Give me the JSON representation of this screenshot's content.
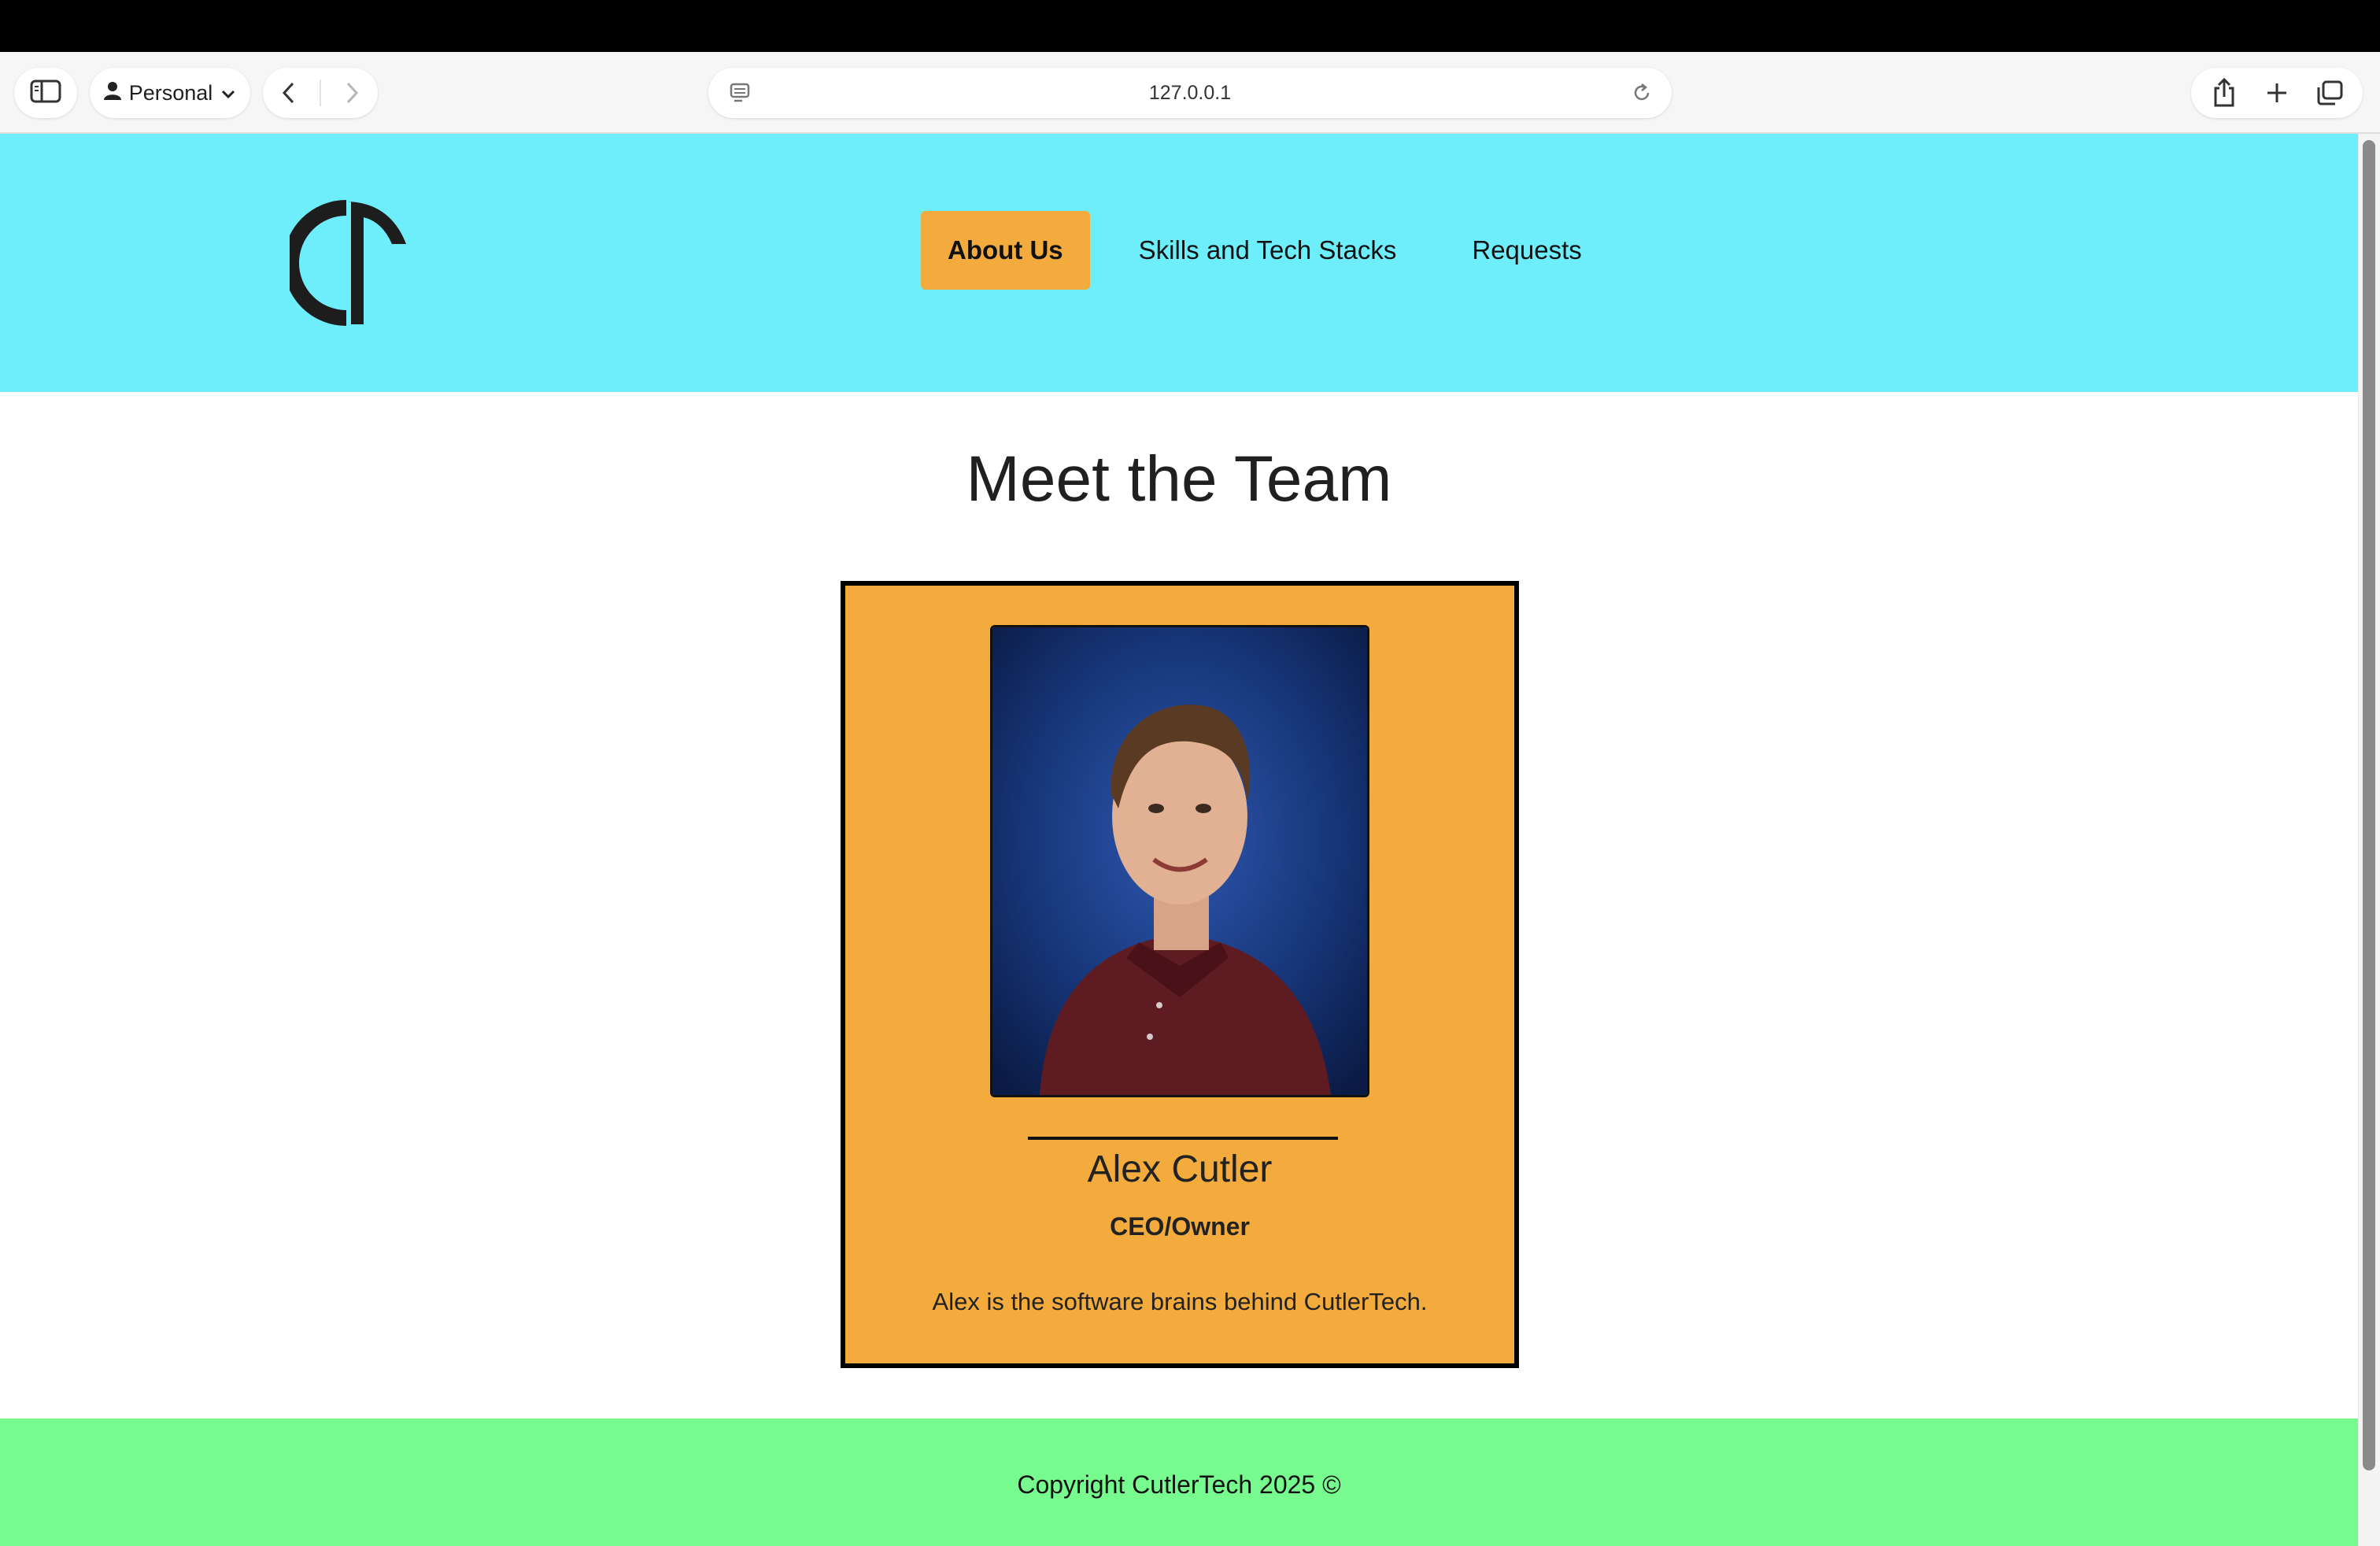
{
  "browser": {
    "profile_label": "Personal",
    "address": "127.0.0.1"
  },
  "nav": {
    "items": [
      {
        "label": "About Us",
        "active": true
      },
      {
        "label": "Skills and Tech Stacks",
        "active": false
      },
      {
        "label": "Requests",
        "active": false
      }
    ]
  },
  "colors": {
    "header_bg": "#6eedfb",
    "accent": "#f2ab3c",
    "footer_bg": "#77fb8f"
  },
  "main": {
    "title": "Meet the Team",
    "member": {
      "name": "Alex Cutler",
      "role": "CEO/Owner",
      "bio": "Alex is the software brains behind CutlerTech."
    }
  },
  "footer": {
    "copyright": "Copyright CutlerTech 2025 ©"
  }
}
